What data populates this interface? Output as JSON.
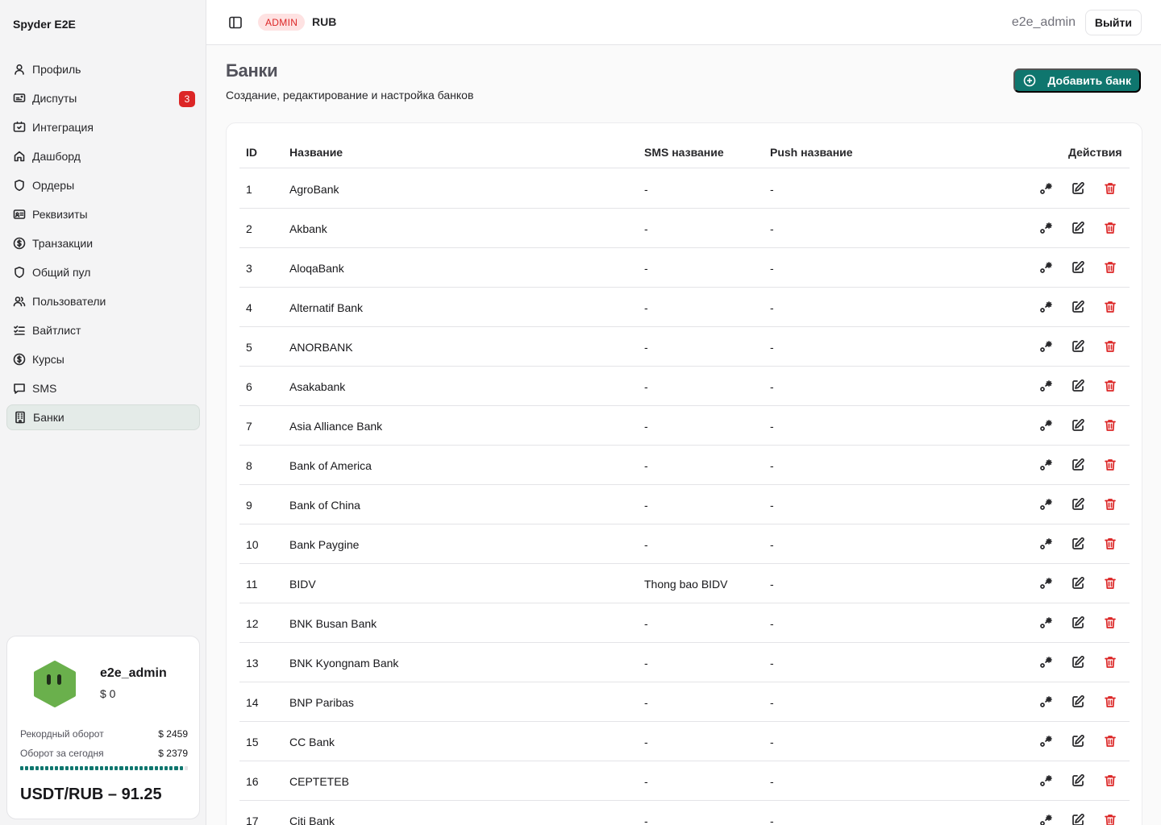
{
  "app": {
    "brand": "Spyder E2E"
  },
  "sidebar": {
    "items": [
      {
        "label": "Профиль",
        "icon": "user-icon"
      },
      {
        "label": "Диспуты",
        "icon": "dispute-icon",
        "badge": "3"
      },
      {
        "label": "Интеграция",
        "icon": "integration-icon"
      },
      {
        "label": "Дашборд",
        "icon": "home-icon"
      },
      {
        "label": "Ордеры",
        "icon": "shield-icon"
      },
      {
        "label": "Реквизиты",
        "icon": "id-card-icon"
      },
      {
        "label": "Транзакции",
        "icon": "dollar-circle-icon"
      },
      {
        "label": "Общий пул",
        "icon": "shield-icon"
      },
      {
        "label": "Пользователи",
        "icon": "users-icon"
      },
      {
        "label": "Вайтлист",
        "icon": "checklist-icon"
      },
      {
        "label": "Курсы",
        "icon": "dollar-circle-icon"
      },
      {
        "label": "SMS",
        "icon": "message-icon"
      },
      {
        "label": "Банки",
        "icon": "building-icon",
        "active": true
      }
    ]
  },
  "user_card": {
    "username": "e2e_admin",
    "balance": "$ 0",
    "record_label": "Рекордный оборот",
    "record_value": "$ 2459",
    "today_label": "Оборот за сегодня",
    "today_value": "$ 2379",
    "today_progress": 0.97,
    "rate": "USDT/RUB – 91.25"
  },
  "topbar": {
    "role_badge": "ADMIN",
    "currency": "RUB",
    "username": "e2e_admin",
    "logout_label": "Выйти"
  },
  "page": {
    "title": "Банки",
    "subtitle": "Создание, редактирование и настройка банков",
    "add_button": "Добавить банк"
  },
  "table": {
    "headers": {
      "id": "ID",
      "name": "Название",
      "sms": "SMS название",
      "push": "Push название",
      "actions": "Действия"
    },
    "rows": [
      {
        "id": "1",
        "name": "AgroBank",
        "sms": "-",
        "push": "-"
      },
      {
        "id": "2",
        "name": "Akbank",
        "sms": "-",
        "push": "-"
      },
      {
        "id": "3",
        "name": "AloqaBank",
        "sms": "-",
        "push": "-"
      },
      {
        "id": "4",
        "name": "Alternatif Bank",
        "sms": "-",
        "push": "-"
      },
      {
        "id": "5",
        "name": "ANORBANK",
        "sms": "-",
        "push": "-"
      },
      {
        "id": "6",
        "name": "Asakabank",
        "sms": "-",
        "push": "-"
      },
      {
        "id": "7",
        "name": "Asia Alliance Bank",
        "sms": "-",
        "push": "-"
      },
      {
        "id": "8",
        "name": "Bank of America",
        "sms": "-",
        "push": "-"
      },
      {
        "id": "9",
        "name": "Bank of China",
        "sms": "-",
        "push": "-"
      },
      {
        "id": "10",
        "name": "Bank Paygine",
        "sms": "-",
        "push": "-"
      },
      {
        "id": "11",
        "name": "BIDV",
        "sms": "Thong bao BIDV",
        "push": "-"
      },
      {
        "id": "12",
        "name": "BNK Busan Bank",
        "sms": "-",
        "push": "-"
      },
      {
        "id": "13",
        "name": "BNK Kyongnam Bank",
        "sms": "-",
        "push": "-"
      },
      {
        "id": "14",
        "name": "BNP Paribas",
        "sms": "-",
        "push": "-"
      },
      {
        "id": "15",
        "name": "CC Bank",
        "sms": "-",
        "push": "-"
      },
      {
        "id": "16",
        "name": "CEPTETEB",
        "sms": "-",
        "push": "-"
      },
      {
        "id": "17",
        "name": "Citi Bank",
        "sms": "-",
        "push": "-"
      }
    ]
  },
  "colors": {
    "accent": "#0f766e",
    "danger": "#dc2626",
    "avatar": "#6ab04c"
  }
}
